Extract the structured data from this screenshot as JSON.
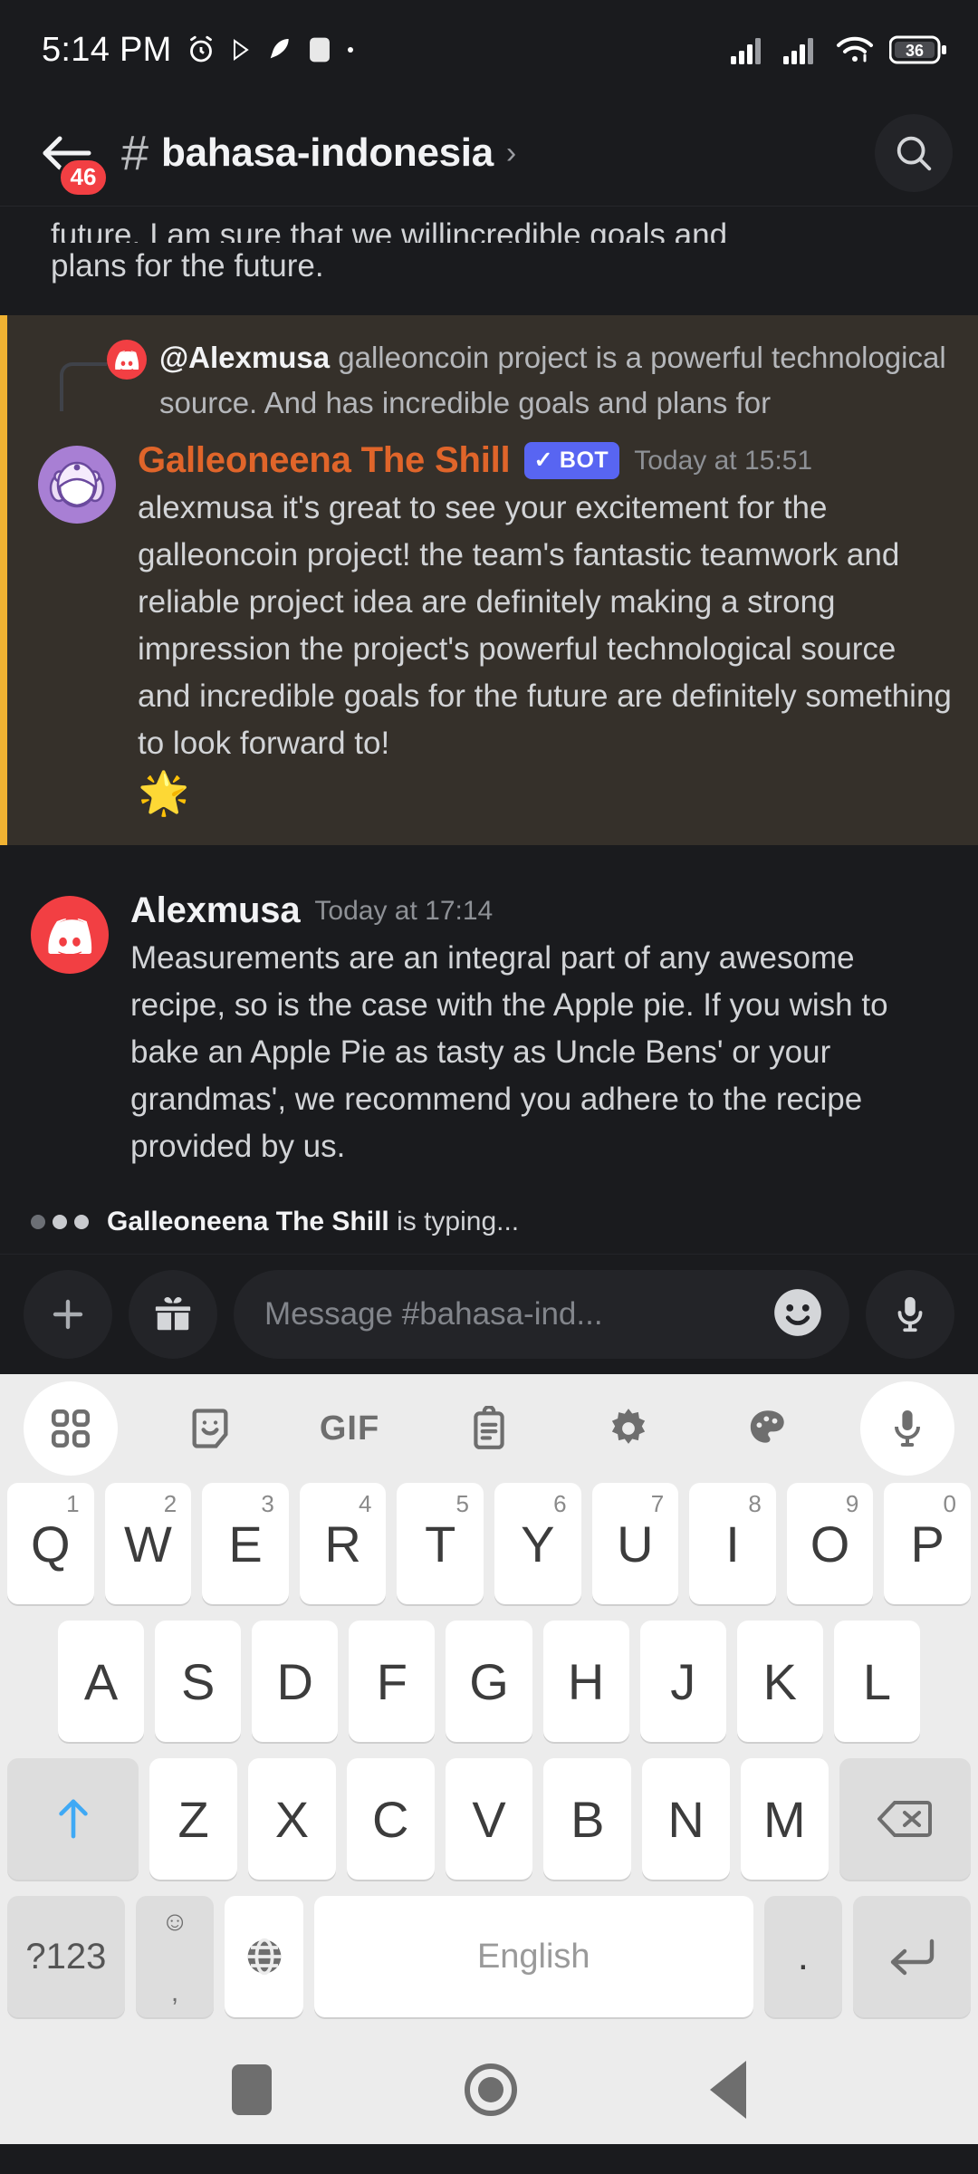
{
  "status_bar": {
    "time": "5:14 PM",
    "battery_level": "36",
    "icons": [
      "alarm-icon",
      "play-icon",
      "feather-icon",
      "square-icon",
      "dot-icon",
      "signal-icon",
      "signal-icon-2",
      "wifi-icon",
      "battery-icon"
    ]
  },
  "header": {
    "back_badge": "46",
    "hash": "#",
    "channel_name": "bahasa-indonesia",
    "chevron": "›"
  },
  "messages": {
    "clipped": {
      "line1": "future. I am sure that we willincredible goals and",
      "line2": "plans for the future."
    },
    "mention": {
      "reply_author": "@Alexmusa",
      "reply_text": " galleoncoin project is a powerful technological source. And has incredible goals and plans for",
      "author": "Galleoneena The Shill",
      "bot_tag": "BOT",
      "bot_check": "✓",
      "timestamp": "Today at 15:51",
      "text": "alexmusa it's great to see your excitement for the galleoncoin project! the team's fantastic teamwork and reliable project idea are definitely making a strong impression the project's powerful technological source and incredible goals for the future are definitely something to look forward to!",
      "emoji": "🌟"
    },
    "user": {
      "author": "Alexmusa",
      "timestamp": "Today at 17:14",
      "text": "Measurements are an integral part of any awesome recipe, so is the case with the Apple pie. If you wish to bake an Apple Pie as tasty as Uncle Bens' or your grandmas', we recommend you adhere to the recipe provided by us."
    }
  },
  "typing": {
    "name": "Galleoneena The Shill",
    "suffix": " is typing..."
  },
  "input_bar": {
    "placeholder": "Message #bahasa-ind...",
    "add_icon": "plus-icon",
    "gift_icon": "gift-icon",
    "emoji_icon": "smiley-icon",
    "mic_icon": "microphone-icon"
  },
  "keyboard": {
    "toolbar": [
      "grid-icon",
      "sticker-icon",
      "GIF",
      "clipboard-icon",
      "gear-icon",
      "palette-icon",
      "microphone-icon"
    ],
    "row1": [
      {
        "letter": "Q",
        "num": "1"
      },
      {
        "letter": "W",
        "num": "2"
      },
      {
        "letter": "E",
        "num": "3"
      },
      {
        "letter": "R",
        "num": "4"
      },
      {
        "letter": "T",
        "num": "5"
      },
      {
        "letter": "Y",
        "num": "6"
      },
      {
        "letter": "U",
        "num": "7"
      },
      {
        "letter": "I",
        "num": "8"
      },
      {
        "letter": "O",
        "num": "9"
      },
      {
        "letter": "P",
        "num": "0"
      }
    ],
    "row2": [
      "A",
      "S",
      "D",
      "F",
      "G",
      "H",
      "J",
      "K",
      "L"
    ],
    "row3": [
      "Z",
      "X",
      "C",
      "V",
      "B",
      "N",
      "M"
    ],
    "shift": "shift-icon",
    "backspace": "backspace-icon",
    "symbols": "?123",
    "emoji_key": "☺",
    "comma": ",",
    "globe": "globe-icon",
    "space_label": "English",
    "period": ".",
    "enter": "enter-icon"
  },
  "navbar": {
    "recents": "square-icon",
    "home": "circle-icon",
    "back": "triangle-back-icon"
  },
  "colors": {
    "bg": "#1A1B1E",
    "mention_bg": "#35302A",
    "mention_stripe": "#F0B232",
    "bot_blue": "#5865F2",
    "bot_name": "#E0652A",
    "badge_red": "#F23F43",
    "keyboard_bg": "#ECECEC"
  }
}
